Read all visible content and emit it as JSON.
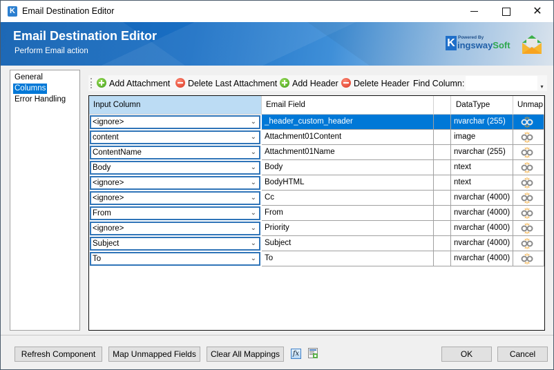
{
  "window": {
    "title": "Email Destination Editor",
    "controls": [
      "minimize",
      "maximize",
      "close"
    ]
  },
  "banner": {
    "title": "Email Destination Editor",
    "subtitle": "Perform Email action",
    "logo": {
      "powered_by": "Powered By",
      "k": "K",
      "name_main": "ingsway",
      "name_accent": "Soft"
    }
  },
  "nav": {
    "items": [
      {
        "label": "General",
        "selected": false
      },
      {
        "label": "Columns",
        "selected": true
      },
      {
        "label": "Error Handling",
        "selected": false
      }
    ]
  },
  "toolbar": {
    "add_attachment": "Add Attachment",
    "delete_last_attachment": "Delete Last Attachment",
    "add_header": "Add Header",
    "delete_header": "Delete Header",
    "find_column_label": "Find Column:",
    "find_column_value": ""
  },
  "grid": {
    "headers": {
      "input_column": "Input Column",
      "email_field": "Email Field",
      "blank": "",
      "data_type": "DataType",
      "unmap": "Unmap"
    },
    "rows": [
      {
        "input": "<ignore>",
        "field": "_header_custom_header",
        "dtype": "nvarchar (255)",
        "selected": true
      },
      {
        "input": "content",
        "field": "Attachment01Content",
        "dtype": "image",
        "selected": false
      },
      {
        "input": "ContentName",
        "field": "Attachment01Name",
        "dtype": "nvarchar (255)",
        "selected": false
      },
      {
        "input": "Body",
        "field": "Body",
        "dtype": "ntext",
        "selected": false
      },
      {
        "input": "<ignore>",
        "field": "BodyHTML",
        "dtype": "ntext",
        "selected": false
      },
      {
        "input": "<ignore>",
        "field": "Cc",
        "dtype": "nvarchar (4000)",
        "selected": false
      },
      {
        "input": "From",
        "field": "From",
        "dtype": "nvarchar (4000)",
        "selected": false
      },
      {
        "input": "<ignore>",
        "field": "Priority",
        "dtype": "nvarchar (4000)",
        "selected": false
      },
      {
        "input": "Subject",
        "field": "Subject",
        "dtype": "nvarchar (4000)",
        "selected": false
      },
      {
        "input": "To",
        "field": "To",
        "dtype": "nvarchar (4000)",
        "selected": false
      }
    ]
  },
  "footer": {
    "refresh": "Refresh Component",
    "map_unmapped": "Map Unmapped Fields",
    "clear_all": "Clear All Mappings",
    "fx_label": "fx",
    "ok": "OK",
    "cancel": "Cancel"
  },
  "colors": {
    "selection": "#0078d7",
    "header_highlight": "#bcdcf4",
    "combo_border": "#2f74b8",
    "brand_blue": "#1f6fc9"
  }
}
